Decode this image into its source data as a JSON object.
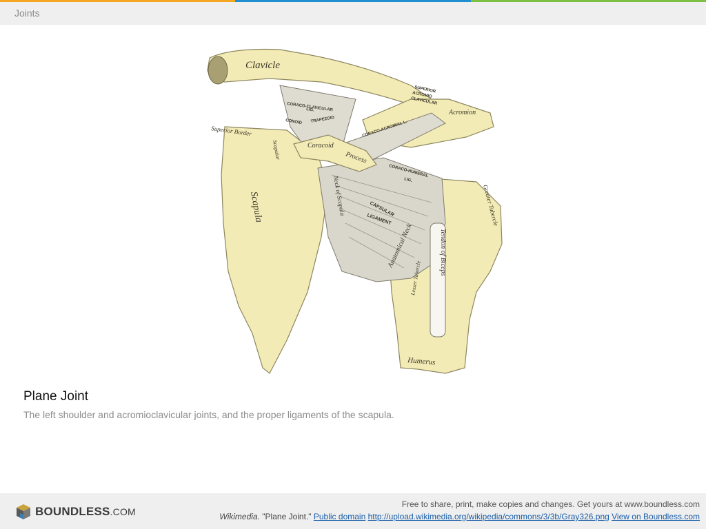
{
  "colors": {
    "bar_orange": "#f5a623",
    "bar_blue": "#1f8fd0",
    "bar_green": "#7dc142",
    "bone": "#f2ebb5",
    "ligament": "#d9d6cc",
    "ink": "#3a352a"
  },
  "header": {
    "title": "Joints"
  },
  "figure": {
    "labels": {
      "clavicle": "Clavicle",
      "superior_acromio_clavicular": [
        "SUPERIOR",
        "ACROMIO",
        "CLAVICULAR"
      ],
      "acromion": "Acromion",
      "coraco_clavicular": "CORACO-CLAVICULAR",
      "lig": "LIG.",
      "conoid": "CONOID",
      "trapezoid": "TRAPEZOID",
      "coraco_acromial": "CORACO-ACROMIAL L.",
      "superior_border": "Superior Border",
      "coracoid_process": "Coracoid",
      "process": "Process",
      "scapular_notch": "Scapular",
      "coraco_humeral": "CORACO-HUMERAL",
      "coraco_humeral_lig": "LIG.",
      "greater_tubercle": "Greater Tubercle",
      "neck_of_scapula": "Neck of Scapula",
      "anatomical_neck": "Anatomical Neck",
      "capsular": "CAPSULAR",
      "ligament": "LIGAMENT",
      "scapula": "Scapula",
      "tendon_of_biceps": "Tendon of Biceps",
      "lesser_tubercle": "Lesser Tubercle",
      "humerus": "Humerus"
    }
  },
  "caption": {
    "title": "Plane Joint",
    "description": "The left shoulder and acromioclavicular joints, and the proper ligaments of the scapula."
  },
  "footer": {
    "logo_main": "BOUNDLESS",
    "logo_suffix": ".COM",
    "line1": "Free to share, print, make copies and changes. Get yours at www.boundless.com",
    "source": "Wikimedia.",
    "attribution": "\"Plane Joint.\"",
    "license_link": "Public domain",
    "url_link": "http://upload.wikimedia.org/wikipedia/commons/3/3b/Gray326.png",
    "view_link": "View on Boundless.com"
  }
}
